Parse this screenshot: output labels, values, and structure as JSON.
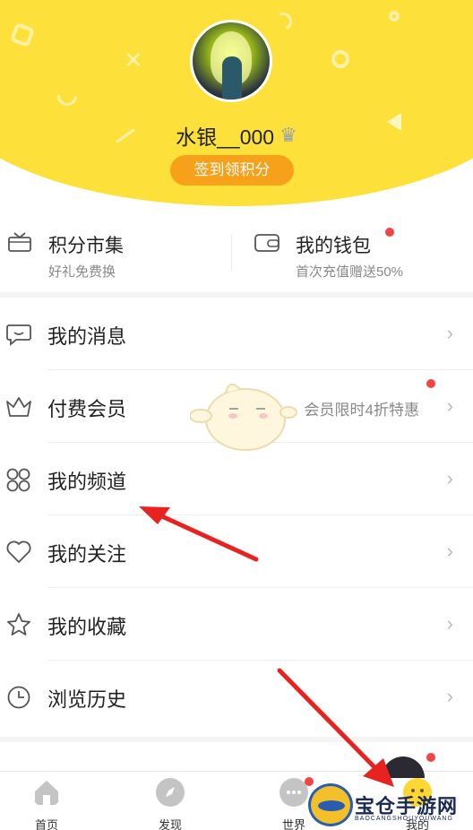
{
  "profile": {
    "username": "水银__000",
    "signin_label": "签到领积分"
  },
  "quick": {
    "points_market": {
      "title": "积分市集",
      "subtitle": "好礼免费换"
    },
    "wallet": {
      "title": "我的钱包",
      "subtitle": "首次充值赠送50%"
    }
  },
  "menu": {
    "items": [
      {
        "label": "我的消息",
        "icon": "message-icon"
      },
      {
        "label": "付费会员",
        "icon": "crown-icon",
        "extra": "会员限时4折特惠"
      },
      {
        "label": "我的频道",
        "icon": "grid-icon"
      },
      {
        "label": "我的关注",
        "icon": "heart-icon"
      },
      {
        "label": "我的收藏",
        "icon": "star-icon"
      },
      {
        "label": "浏览历史",
        "icon": "clock-icon"
      }
    ]
  },
  "tabbar": {
    "tabs": [
      {
        "label": "首页",
        "icon": "home-icon"
      },
      {
        "label": "发现",
        "icon": "compass-icon"
      },
      {
        "label": "世界",
        "icon": "chat-icon"
      },
      {
        "label": "我的",
        "icon": "profile-icon"
      }
    ]
  },
  "watermark": {
    "title": "宝仓手游网",
    "subtitle": "BAOCANGSHOUYOUWANG"
  },
  "colors": {
    "header_yellow": "#fde13a",
    "signin_orange": "#f7a11a",
    "badge_red": "#f24444",
    "annotation_red": "#e8231f"
  }
}
